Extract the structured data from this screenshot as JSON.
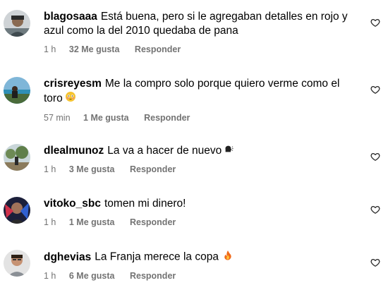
{
  "comments": [
    {
      "username": "blagosaaa",
      "text": "Está buena, pero si le agregaban detalles en rojo y azul como la del 2010 quedaba de pana",
      "time": "1 h",
      "likes": "32 Me gusta",
      "reply": "Responder",
      "avatar_icon": "avatar-photo",
      "heart_icon": "heart-outline-icon"
    },
    {
      "username": "crisreyesm",
      "text": "Me la compro solo porque quiero verme como el toro",
      "emoji": "flushed-face-emoji",
      "time": "57 min",
      "likes": "1 Me gusta",
      "reply": "Responder",
      "avatar_icon": "avatar-photo",
      "heart_icon": "heart-outline-icon"
    },
    {
      "username": "dlealmunoz",
      "text": "La va a hacer de nuevo",
      "emoji": "speaking-head-emoji",
      "time": "1 h",
      "likes": "3 Me gusta",
      "reply": "Responder",
      "avatar_icon": "avatar-photo",
      "heart_icon": "heart-outline-icon"
    },
    {
      "username": "vitoko_sbc",
      "text": "tomen mi dinero!",
      "time": "1 h",
      "likes": "1 Me gusta",
      "reply": "Responder",
      "avatar_icon": "avatar-photo",
      "heart_icon": "heart-outline-icon"
    },
    {
      "username": "dghevias",
      "text": "La Franja merece la copa",
      "emoji": "fire-emoji",
      "time": "1 h",
      "likes": "6 Me gusta",
      "reply": "Responder",
      "avatar_icon": "avatar-photo",
      "heart_icon": "heart-outline-icon"
    }
  ],
  "colors": {
    "text": "#000000",
    "meta": "#737373",
    "background": "#ffffff"
  }
}
